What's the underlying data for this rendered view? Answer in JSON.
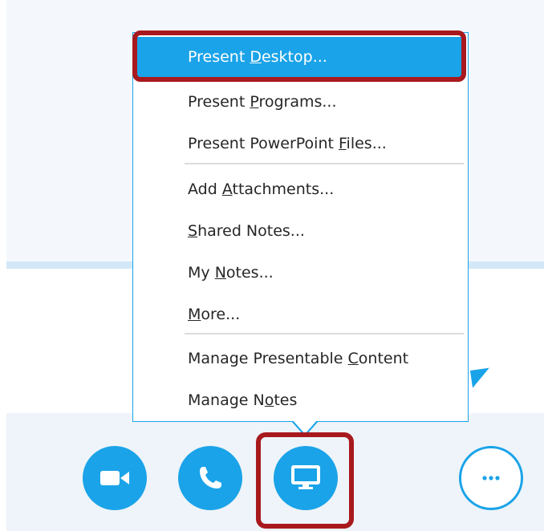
{
  "menu": {
    "items": [
      {
        "pre": "Present ",
        "key": "D",
        "post": "esktop...",
        "selected": true
      },
      {
        "pre": "Present ",
        "key": "P",
        "post": "rograms...",
        "selected": false
      },
      {
        "pre": "Present PowerPoint ",
        "key": "F",
        "post": "iles...",
        "selected": false
      },
      {
        "pre": "Add ",
        "key": "A",
        "post": "ttachments...",
        "selected": false
      },
      {
        "pre": "",
        "key": "S",
        "post": "hared Notes...",
        "selected": false
      },
      {
        "pre": "My ",
        "key": "N",
        "post": "otes...",
        "selected": false
      },
      {
        "pre": "",
        "key": "M",
        "post": "ore...",
        "selected": false
      },
      {
        "pre": "Manage Presentable ",
        "key": "C",
        "post": "ontent",
        "selected": false
      },
      {
        "pre": "Manage N",
        "key": "o",
        "post": "tes",
        "selected": false
      }
    ]
  },
  "toolbar": {
    "buttons": [
      {
        "name": "video-button",
        "icon": "video-camera-icon"
      },
      {
        "name": "call-button",
        "icon": "phone-icon"
      },
      {
        "name": "present-button",
        "icon": "monitor-icon"
      },
      {
        "name": "more-options-button",
        "icon": "ellipsis-icon"
      }
    ]
  },
  "colors": {
    "accent": "#1aa3e8",
    "highlight": "#a8191e",
    "menu_text": "#262626",
    "toolbar_bg": "#eef4f9"
  }
}
